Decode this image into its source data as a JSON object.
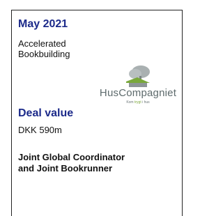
{
  "deal": {
    "date": "May 2021",
    "type_line1": "Accelerated",
    "type_line2": "Bookbuilding",
    "value_title": "Deal value",
    "value": "DKK 590m",
    "role_line1": "Joint Global Coordinator",
    "role_line2": "and Joint Bookrunner"
  },
  "logo": {
    "name": "HusCompagniet",
    "tagline_prefix": "Kom ",
    "tagline_highlight": "trygt",
    "tagline_suffix": " i hus",
    "icon": "tree-house-icon"
  },
  "colors": {
    "heading": "#1c2a8a",
    "logo_text": "#5d6a6c",
    "logo_accent": "#7aa53a"
  }
}
